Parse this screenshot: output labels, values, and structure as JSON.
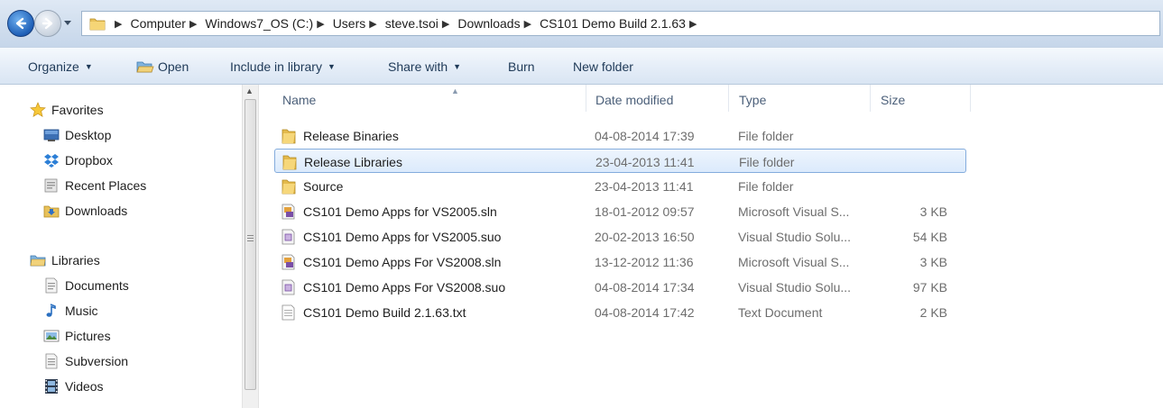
{
  "address_bar": {
    "breadcrumbs": [
      "Computer",
      "Windows7_OS (C:)",
      "Users",
      "steve.tsoi",
      "Downloads",
      "CS101 Demo Build 2.1.63"
    ]
  },
  "toolbar": {
    "organize": "Organize",
    "open": "Open",
    "include_in_library": "Include in library",
    "share_with": "Share with",
    "burn": "Burn",
    "new_folder": "New folder"
  },
  "navigation": {
    "favorites": {
      "label": "Favorites",
      "items": [
        "Desktop",
        "Dropbox",
        "Recent Places",
        "Downloads"
      ]
    },
    "libraries": {
      "label": "Libraries",
      "items": [
        "Documents",
        "Music",
        "Pictures",
        "Subversion",
        "Videos"
      ]
    }
  },
  "file_list": {
    "columns": {
      "name": "Name",
      "date_modified": "Date modified",
      "type": "Type",
      "size": "Size"
    },
    "rows": [
      {
        "name": "Release Binaries",
        "date": "04-08-2014 17:39",
        "type": "File folder",
        "size": "",
        "icon": "folder-icon"
      },
      {
        "name": "Release Libraries",
        "date": "23-04-2013 11:41",
        "type": "File folder",
        "size": "",
        "icon": "folder-icon"
      },
      {
        "name": "Source",
        "date": "23-04-2013 11:41",
        "type": "File folder",
        "size": "",
        "icon": "folder-icon"
      },
      {
        "name": "CS101 Demo Apps for VS2005.sln",
        "date": "18-01-2012 09:57",
        "type": "Microsoft Visual S...",
        "size": "3 KB",
        "icon": "solution-file-icon"
      },
      {
        "name": "CS101 Demo Apps for VS2005.suo",
        "date": "20-02-2013 16:50",
        "type": "Visual Studio Solu...",
        "size": "54 KB",
        "icon": "suo-file-icon"
      },
      {
        "name": "CS101 Demo Apps For VS2008.sln",
        "date": "13-12-2012 11:36",
        "type": "Microsoft Visual S...",
        "size": "3 KB",
        "icon": "solution-file-icon"
      },
      {
        "name": "CS101 Demo Apps For VS2008.suo",
        "date": "04-08-2014 17:34",
        "type": "Visual Studio Solu...",
        "size": "97 KB",
        "icon": "suo-file-icon"
      },
      {
        "name": "CS101 Demo Build 2.1.63.txt",
        "date": "04-08-2014 17:42",
        "type": "Text Document",
        "size": "2 KB",
        "icon": "text-file-icon"
      }
    ],
    "selected_row": 1
  }
}
